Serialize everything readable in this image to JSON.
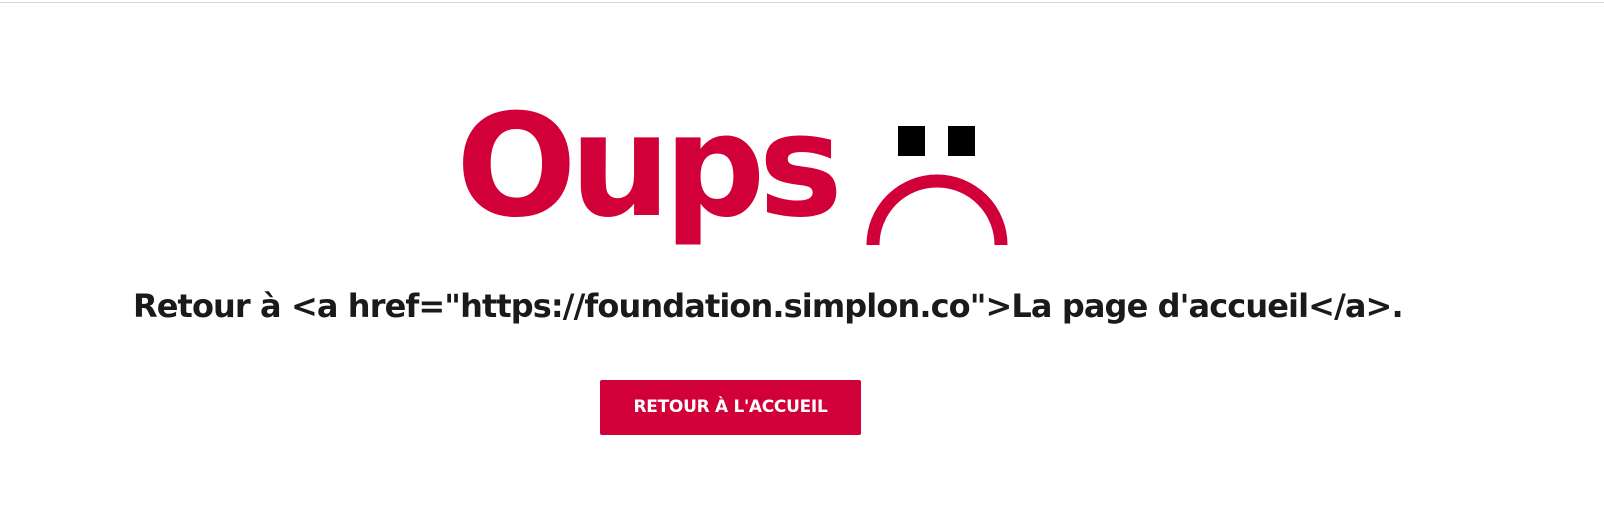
{
  "error_page": {
    "title": "Oups",
    "message": "Retour à <a href=\"https://foundation.simplon.co\">La page d'accueil</a>.",
    "button_label": "RETOUR À L'ACCUEIL",
    "face_icon": "sad-face-icon"
  },
  "colors": {
    "accent": "#d20038",
    "text": "#1a1a1a",
    "face_eyes": "#000000",
    "background": "#ffffff",
    "button_text": "#ffffff"
  }
}
